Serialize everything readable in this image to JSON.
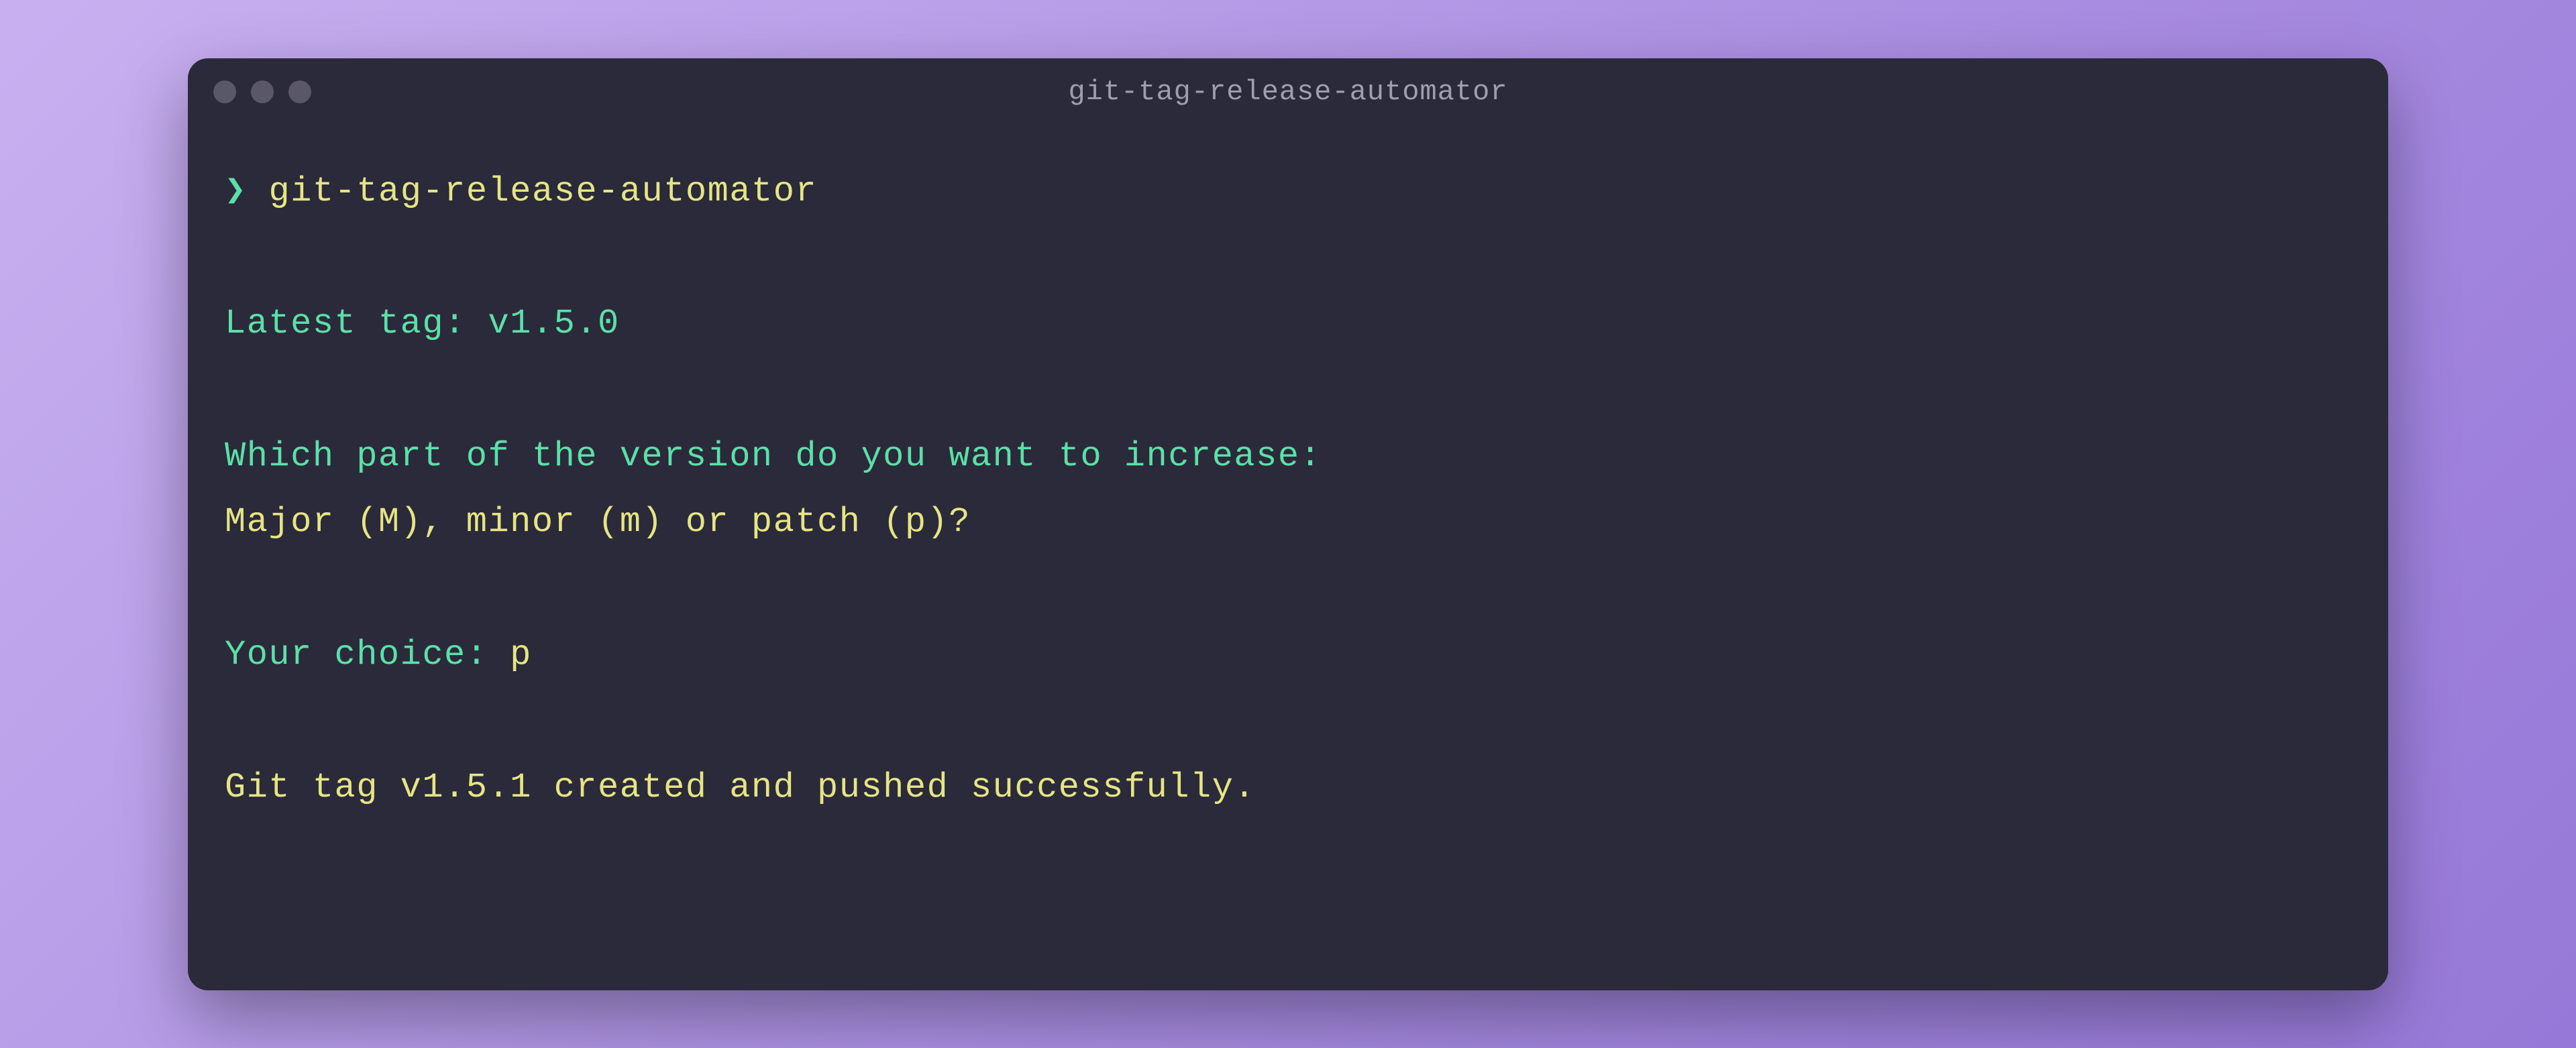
{
  "window": {
    "title": "git-tag-release-automator"
  },
  "terminal": {
    "prompt_symbol": "❯",
    "command": "git-tag-release-automator",
    "latest_tag_label": "Latest tag: ",
    "latest_tag_value": "v1.5.0",
    "question_line": "Which part of the version do you want to increase:",
    "options_line": "Major (M), minor (m) or patch (p)?",
    "choice_label": "Your choice: ",
    "choice_value": "p",
    "result_line": "Git tag v1.5.1 created and pushed successfully."
  }
}
